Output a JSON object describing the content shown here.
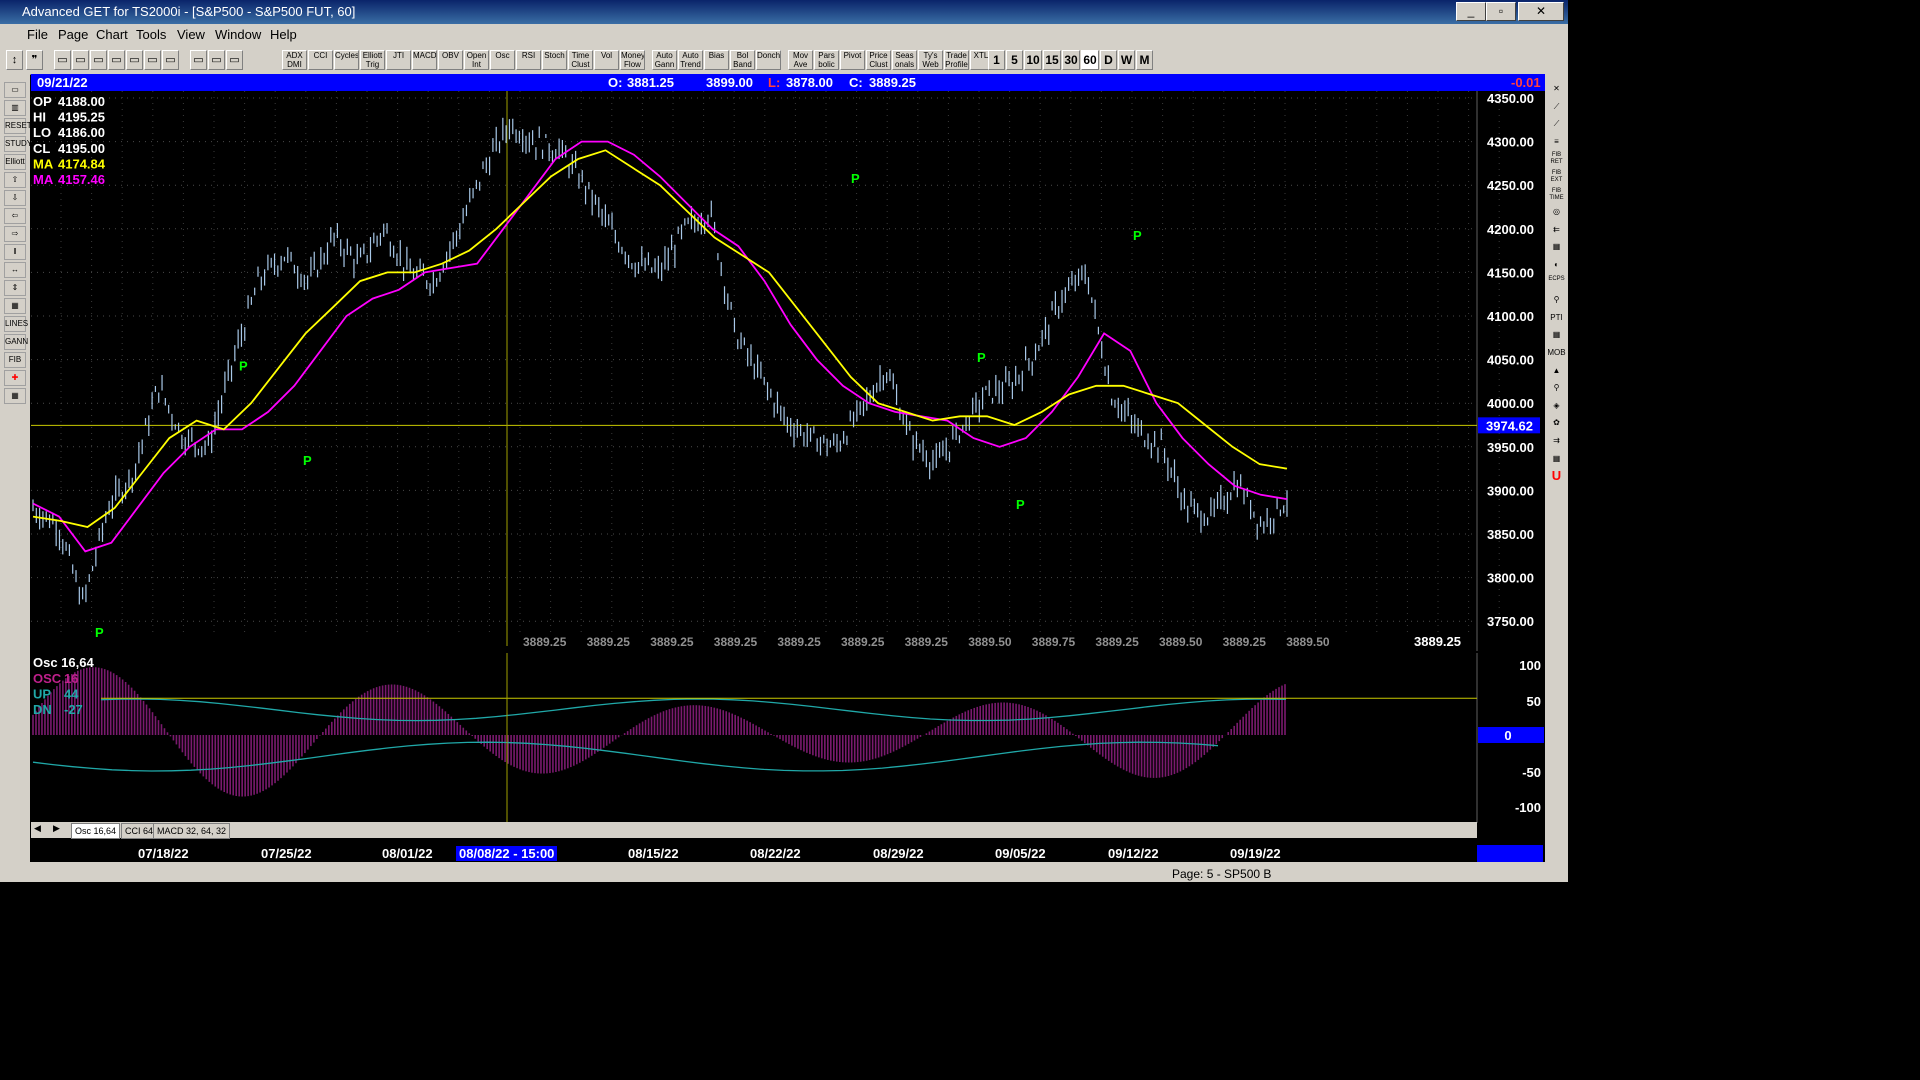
{
  "window": {
    "title": "Advanced GET for TS2000i - [S&P500 - S&P500 FUT, 60]"
  },
  "menu": [
    "File",
    "Page",
    "Chart",
    "Tools",
    "View",
    "Window",
    "Help"
  ],
  "toolbar": {
    "studies": [
      "ADX DMI",
      "CCI",
      "Cycles",
      "Elliott Trig",
      "JTI",
      "MACD",
      "OBV",
      "Open Int",
      "Osc",
      "RSI",
      "Stoch",
      "Time Clust",
      "Vol",
      "Money Flow",
      "Auto Gann",
      "Auto Trend",
      "Bias",
      "Bol Band",
      "Donch",
      "Mov Ave",
      "Pars bolic",
      "Pivot",
      "Price Clust",
      "Seas onals",
      "Ty's Web",
      "Trade Profile",
      "XTL"
    ],
    "intervals": [
      "1",
      "5",
      "10",
      "15",
      "30",
      "60",
      "D",
      "W",
      "M"
    ]
  },
  "left_tools": [
    "RESET",
    "STUDY",
    "Elliott",
    "LINES",
    "GANN",
    "FIB"
  ],
  "right_tools": [
    "FIB RET",
    "FIB EXT",
    "FIB TIME",
    "ECPS",
    "PTI",
    "MOB"
  ],
  "infobar": {
    "date": "09/21/22",
    "open_label": "O:",
    "open": "3881.25",
    "high": "3899.00",
    "low_label": "L:",
    "low": "3878.00",
    "close_label": "C:",
    "close": "3889.25",
    "change": "-0.01"
  },
  "readout": [
    {
      "label": "OP",
      "value": "4188.00",
      "color": "#ffffff"
    },
    {
      "label": "HI",
      "value": "4195.25",
      "color": "#ffffff"
    },
    {
      "label": "LO",
      "value": "4186.00",
      "color": "#ffffff"
    },
    {
      "label": "CL",
      "value": "4195.00",
      "color": "#ffffff"
    },
    {
      "label": "MA",
      "value": "4174.84",
      "color": "#ffff00"
    },
    {
      "label": "MA",
      "value": "4157.46",
      "color": "#ff00ff"
    }
  ],
  "price_axis": [
    "4350.00",
    "4300.00",
    "4250.00",
    "4200.00",
    "4150.00",
    "4100.00",
    "4050.00",
    "4000.00",
    "3950.00",
    "3900.00",
    "3850.00",
    "3800.00",
    "3750.00"
  ],
  "crosshair_price": "3974.62",
  "last_price": "3889.25",
  "bottom_values": [
    "3889.25",
    "3889.25",
    "3889.25",
    "3889.25",
    "3889.25",
    "3889.25",
    "3889.25",
    "3889.50",
    "3889.75",
    "3889.25",
    "3889.50",
    "3889.25",
    "3889.50"
  ],
  "pivot_label": "P",
  "osc_panel": {
    "title": "Osc 16,64",
    "lines": [
      {
        "label": "OSC",
        "value": "16",
        "color": "#c0208c"
      },
      {
        "label": "UP",
        "value": "44",
        "color": "#20a8a8"
      },
      {
        "label": "DN",
        "value": "-27",
        "color": "#20a8a8"
      }
    ],
    "axis": [
      "100",
      "50",
      "0",
      "-50",
      "-100"
    ]
  },
  "tabs": [
    "Osc 16,64",
    "CCI 64",
    "MACD 32, 64, 32"
  ],
  "date_axis": [
    "07/18/22",
    "07/25/22",
    "08/01/22",
    "08/08/22 - 15:00",
    "08/15/22",
    "08/22/22",
    "08/29/22",
    "09/05/22",
    "09/12/22",
    "09/19/22"
  ],
  "status": "Page: 5 - SP500 B",
  "chart_data": {
    "type": "candlestick",
    "ylim": [
      3730,
      4355
    ],
    "x": [
      "07/18/22",
      "07/25/22",
      "08/01/22",
      "08/08/22",
      "08/15/22",
      "08/22/22",
      "08/29/22",
      "09/05/22",
      "09/12/22",
      "09/19/22"
    ],
    "series": [
      {
        "name": "Price",
        "color": "#a8c8e8",
        "values": [
          3880,
          3860,
          3770,
          3880,
          3920,
          4020,
          3960,
          3950,
          4050,
          4140,
          4170,
          4140,
          4190,
          4160,
          4200,
          4150,
          4140,
          4200,
          4270,
          4320,
          4300,
          4290,
          4250,
          4200,
          4160,
          4150,
          4200,
          4220,
          4080,
          4030,
          3980,
          3960,
          3950,
          3990,
          4040,
          3960,
          3930,
          3970,
          4010,
          4020,
          4060,
          4120,
          4150,
          4010,
          3970,
          3950,
          3880,
          3870,
          3910,
          3860,
          3890
        ]
      },
      {
        "name": "MA 4174.84",
        "color": "#ffff00",
        "values": [
          3870,
          3865,
          3858,
          3880,
          3920,
          3960,
          3980,
          3970,
          4000,
          4040,
          4080,
          4110,
          4140,
          4150,
          4150,
          4160,
          4175,
          4200,
          4230,
          4260,
          4280,
          4290,
          4270,
          4250,
          4220,
          4190,
          4170,
          4150,
          4110,
          4070,
          4030,
          4000,
          3990,
          3980,
          3985,
          3985,
          3975,
          3990,
          4010,
          4020,
          4020,
          4010,
          4000,
          3975,
          3950,
          3930,
          3925
        ]
      },
      {
        "name": "MA 4157.46",
        "color": "#ff00ff",
        "values": [
          3885,
          3870,
          3830,
          3840,
          3880,
          3920,
          3950,
          3970,
          3970,
          3990,
          4020,
          4060,
          4100,
          4120,
          4130,
          4150,
          4155,
          4160,
          4200,
          4240,
          4280,
          4300,
          4300,
          4285,
          4260,
          4230,
          4200,
          4180,
          4140,
          4090,
          4050,
          4020,
          4000,
          3990,
          3985,
          3980,
          3960,
          3950,
          3960,
          3990,
          4030,
          4080,
          4060,
          4000,
          3960,
          3930,
          3905,
          3895,
          3890
        ]
      }
    ],
    "osc": {
      "osc": 16,
      "up": 44,
      "dn": -27,
      "ylim": [
        -110,
        110
      ]
    }
  }
}
